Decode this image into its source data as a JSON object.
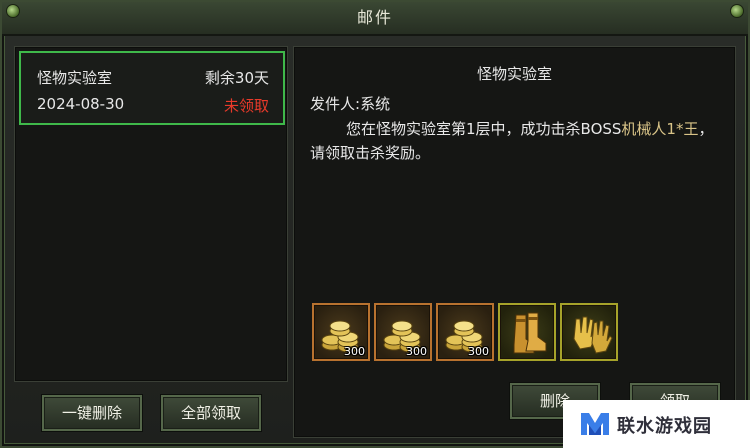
{
  "window": {
    "title": "邮件"
  },
  "mail_list": [
    {
      "subject": "怪物实验室",
      "remaining": "剩余30天",
      "date": "2024-08-30",
      "status": "未领取"
    }
  ],
  "left_buttons": {
    "delete_all": "一键删除",
    "claim_all": "全部领取"
  },
  "detail": {
    "title": "怪物实验室",
    "sender_label": "发件人:",
    "sender_value": "系统",
    "body_part1": "您在怪物实验室第1层中，成功击杀BOSS",
    "body_highlight": "机械人1*王",
    "body_part2": "，请领取击杀奖励。"
  },
  "rewards": [
    {
      "icon": "gold-coins-icon",
      "quantity": "300"
    },
    {
      "icon": "gold-coins-icon",
      "quantity": "300"
    },
    {
      "icon": "gold-coins-icon",
      "quantity": "300"
    },
    {
      "icon": "golden-boots-icon",
      "quantity": ""
    },
    {
      "icon": "golden-gloves-icon",
      "quantity": ""
    }
  ],
  "right_buttons": {
    "delete": "删除",
    "claim": "领取"
  },
  "watermark": {
    "text": "联水游戏园"
  },
  "colors": {
    "selected_border": "#3fb84a",
    "unclaimed": "#e83a2a",
    "highlight": "#d9c488"
  }
}
